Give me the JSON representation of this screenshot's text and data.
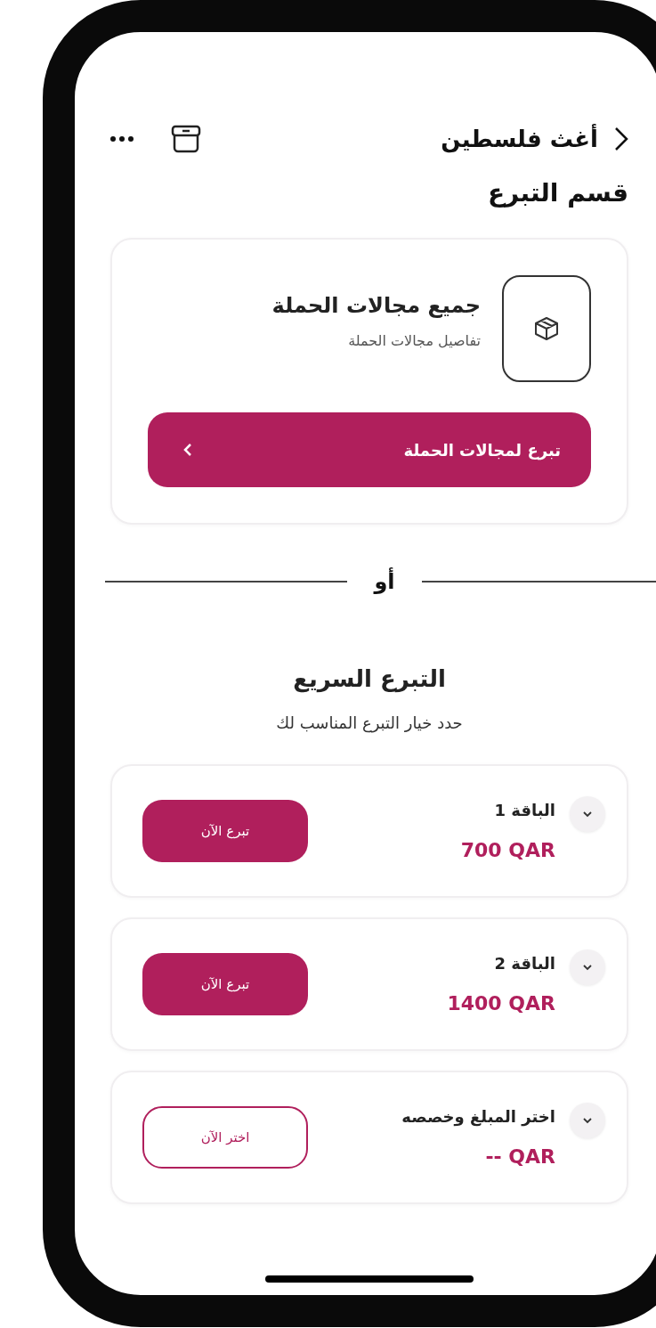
{
  "header": {
    "title": "أغث فلسطين"
  },
  "section_title": "قسم التبرع",
  "campaign_card": {
    "title": "جميع مجالات الحملة",
    "subtitle": "تفاصيل مجالات الحملة",
    "button_label": "تبرع لمجالات الحملة"
  },
  "divider": "أو",
  "quick_donation": {
    "title": "التبرع السريع",
    "subtitle": "حدد خيار التبرع المناسب لك"
  },
  "packages": [
    {
      "kind": "preset",
      "name": "الباقة 1",
      "amount": "700 QAR",
      "button_label": "تبرع الآن"
    },
    {
      "kind": "preset",
      "name": "الباقة 2",
      "amount": "1400 QAR",
      "button_label": "تبرع الآن"
    },
    {
      "kind": "custom",
      "name": "اختر المبلغ وخصصه",
      "amount": "-- QAR",
      "button_label": "اختر الآن"
    }
  ]
}
